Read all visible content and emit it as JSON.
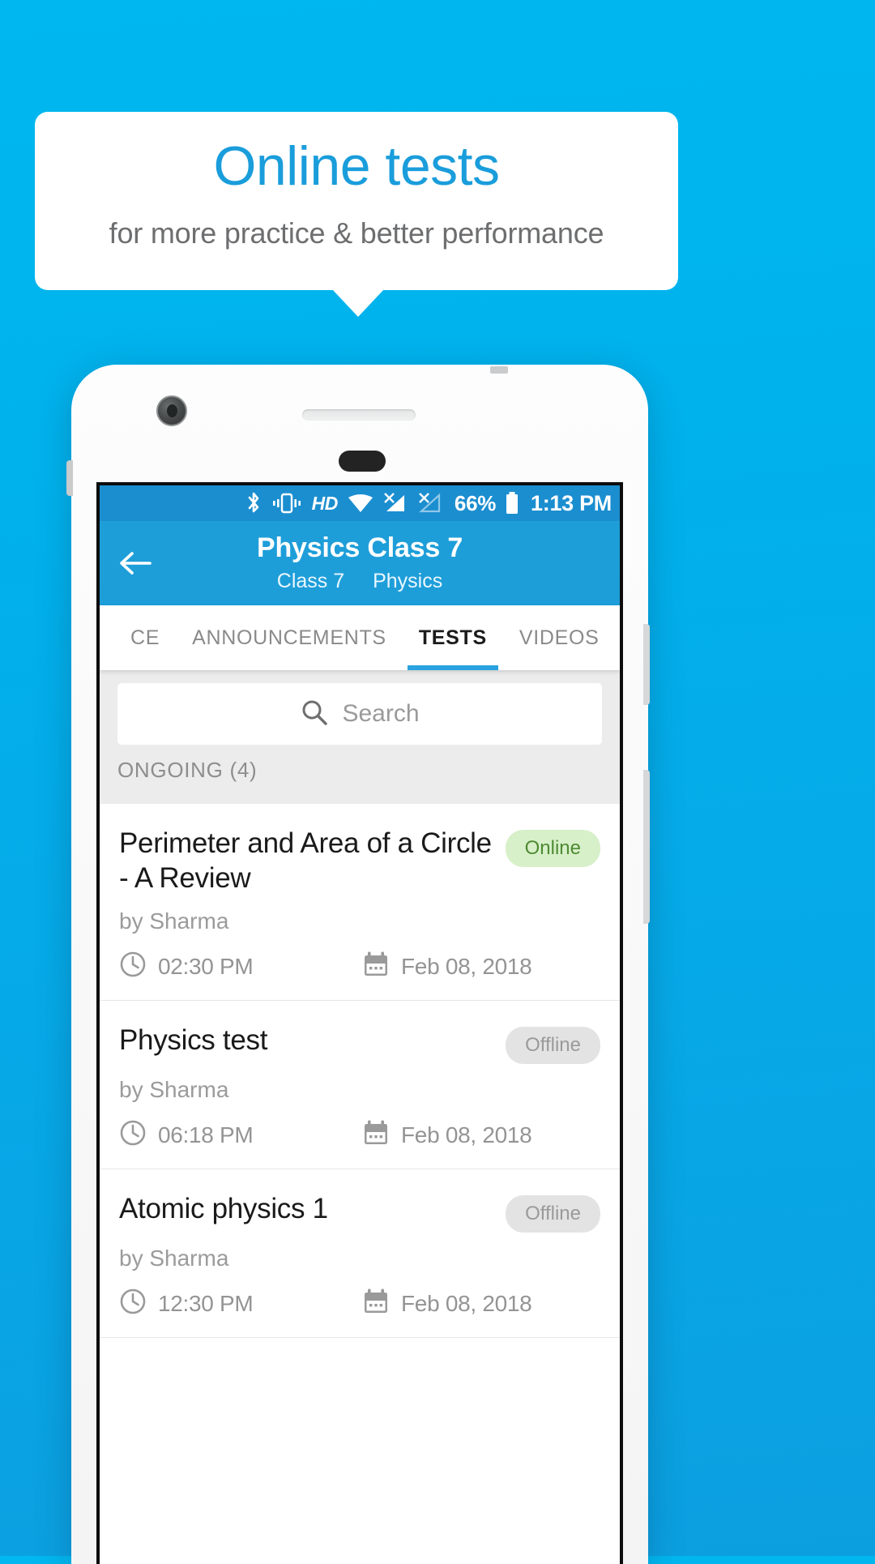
{
  "promo": {
    "title": "Online tests",
    "subtitle": "for more practice & better performance",
    "accent_color": "#1a9ddb",
    "background_color": "#00b4ec"
  },
  "statusbar": {
    "icons": [
      "bluetooth-icon",
      "vibrate-icon",
      "hd-icon",
      "wifi-icon",
      "signal-no-sim-1-icon",
      "signal-no-sim-2-icon"
    ],
    "hd_label": "HD",
    "battery_percent": "66%",
    "time": "1:13 PM"
  },
  "appbar": {
    "back_icon": "back-arrow-icon",
    "title": "Physics Class 7",
    "subtitle_class": "Class 7",
    "subtitle_subject": "Physics",
    "background_color": "#1e9ed9"
  },
  "tabs": [
    {
      "label": "CE",
      "active": false
    },
    {
      "label": "ANNOUNCEMENTS",
      "active": false
    },
    {
      "label": "TESTS",
      "active": true
    },
    {
      "label": "VIDEOS",
      "active": false
    }
  ],
  "search": {
    "icon": "search-icon",
    "placeholder": "Search",
    "value": ""
  },
  "section": {
    "header": "ONGOING (4)"
  },
  "tests": [
    {
      "title": "Perimeter and Area of a Circle - A Review",
      "badge": "Online",
      "badge_type": "online",
      "author": "by Sharma",
      "time": "02:30 PM",
      "date": "Feb 08, 2018"
    },
    {
      "title": "Physics test",
      "badge": "Offline",
      "badge_type": "offline",
      "author": "by Sharma",
      "time": "06:18 PM",
      "date": "Feb 08, 2018"
    },
    {
      "title": "Atomic physics 1",
      "badge": "Offline",
      "badge_type": "offline",
      "author": "by Sharma",
      "time": "12:30 PM",
      "date": "Feb 08, 2018"
    }
  ]
}
